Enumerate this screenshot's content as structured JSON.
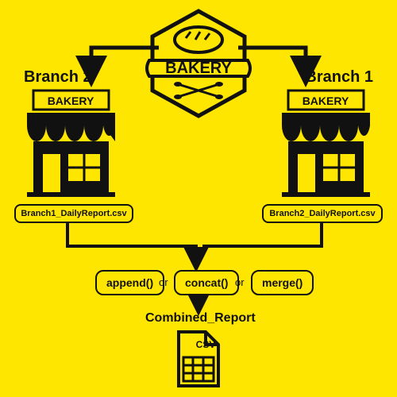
{
  "logo": {
    "text": "BAKERY"
  },
  "branches": {
    "left": {
      "label": "Branch 2",
      "sign": "BAKERY",
      "file": "Branch1_DailyReport.csv"
    },
    "right": {
      "label": "Branch 1",
      "sign": "BAKERY",
      "file": "Branch2_DailyReport.csv"
    }
  },
  "functions": {
    "a": "append()",
    "b": "concat()",
    "c": "merge()",
    "sep": "or"
  },
  "output": {
    "label": "Combined_Report",
    "tag": "CSV"
  }
}
